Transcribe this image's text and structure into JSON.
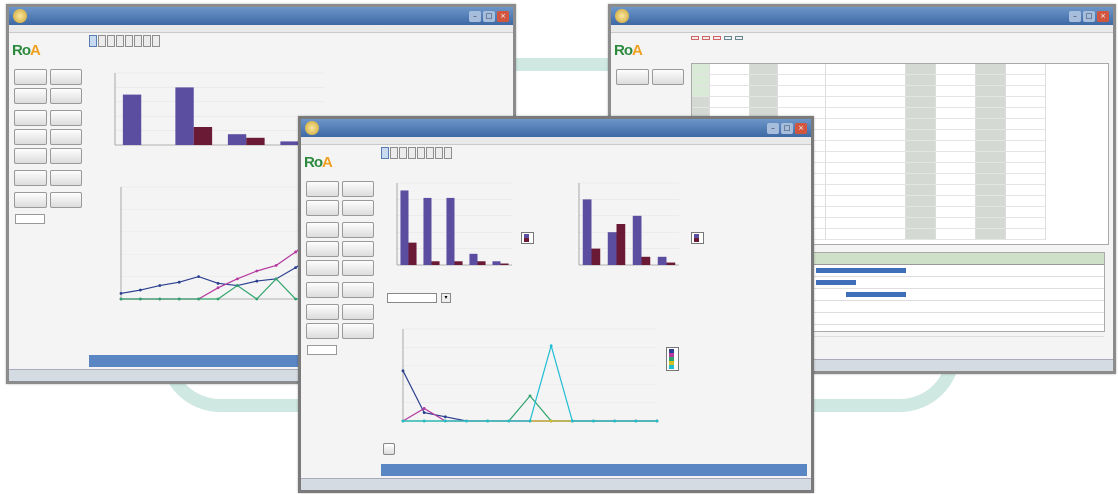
{
  "caption": "",
  "colors": {
    "bar_primary": "#5b4ea0",
    "bar_secondary": "#6b1a36",
    "line_a": "#2a3f8f",
    "line_b": "#b43aa0",
    "line_c": "#2ea36b",
    "line_d": "#d0c027",
    "line_e": "#1fbdd4",
    "status_blue": "#5a86c3"
  },
  "left_window": {
    "title": "",
    "tabs": [
      "",
      "",
      "",
      "",
      "",
      "",
      "",
      ""
    ],
    "chart_titles": [
      "",
      ""
    ],
    "sidebar": {
      "section_labels": [
        "",
        "",
        "",
        "",
        ""
      ],
      "buttons": [
        "",
        "",
        "",
        "",
        "",
        "",
        "",
        "",
        "",
        "",
        "",
        "",
        "",
        "",
        "",
        ""
      ],
      "footer_label": "",
      "footer_value": ""
    },
    "status": [
      "",
      ""
    ]
  },
  "center_window": {
    "title": "",
    "tabs": [
      "",
      "",
      "",
      "",
      "",
      "",
      "",
      ""
    ],
    "chart_titles": [
      "",
      "",
      ""
    ],
    "combo_label": "",
    "combo_value": "",
    "action_button": "",
    "legend_bar1": [
      "",
      ""
    ],
    "legend_bar2": [
      "",
      ""
    ],
    "legend_line": [
      "",
      "",
      "",
      "",
      ""
    ],
    "sidebar": {
      "section_labels": [
        "",
        "",
        "",
        "",
        ""
      ],
      "buttons": [
        "",
        "",
        "",
        "",
        "",
        "",
        "",
        "",
        "",
        "",
        "",
        "",
        "",
        "",
        "",
        ""
      ],
      "footer_label": "",
      "footer_value": ""
    },
    "status": [
      "",
      ""
    ]
  },
  "right_window": {
    "title": "",
    "toolbar": [
      "",
      "",
      "",
      "",
      ""
    ],
    "grid_rows": 16,
    "gantt_rows": 6
  },
  "chart_data": [
    {
      "id": "center-bar-1",
      "type": "bar",
      "title": "",
      "categories": [
        "",
        "",
        "",
        "",
        ""
      ],
      "series": [
        {
          "values": [
            100,
            90,
            90,
            15,
            5
          ]
        },
        {
          "values": [
            30,
            5,
            5,
            5,
            2
          ]
        }
      ],
      "ylim": [
        0,
        110
      ]
    },
    {
      "id": "center-bar-2",
      "type": "bar",
      "title": "",
      "categories": [
        "",
        "",
        "",
        ""
      ],
      "series": [
        {
          "values": [
            8,
            4,
            6,
            1
          ]
        },
        {
          "values": [
            2,
            5,
            1,
            0.3
          ]
        }
      ],
      "ylim": [
        0,
        10
      ]
    },
    {
      "id": "center-line",
      "type": "line",
      "title": "",
      "x": [
        "",
        "",
        "",
        "",
        "",
        "",
        "",
        "",
        "",
        "",
        "",
        "",
        ""
      ],
      "series": [
        {
          "values": [
            60,
            10,
            5,
            0,
            0,
            0,
            0,
            0,
            0,
            0,
            0,
            0,
            0
          ]
        },
        {
          "values": [
            0,
            15,
            0,
            0,
            0,
            0,
            0,
            0,
            0,
            0,
            0,
            0,
            0
          ]
        },
        {
          "values": [
            0,
            0,
            0,
            0,
            0,
            0,
            30,
            0,
            0,
            0,
            0,
            0,
            0
          ]
        },
        {
          "values": [
            0,
            0,
            0,
            0,
            0,
            0,
            0,
            0,
            0,
            0,
            0,
            0,
            0
          ]
        },
        {
          "values": [
            0,
            0,
            0,
            0,
            0,
            0,
            0,
            90,
            0,
            0,
            0,
            0,
            0
          ]
        }
      ],
      "ylim": [
        0,
        110
      ]
    },
    {
      "id": "left-bar",
      "type": "bar",
      "title": "",
      "categories": [
        "",
        "",
        "",
        ""
      ],
      "series": [
        {
          "values": [
            70,
            80,
            15,
            5
          ]
        },
        {
          "values": [
            0,
            25,
            10,
            5
          ]
        }
      ],
      "ylim": [
        0,
        100
      ]
    },
    {
      "id": "left-line",
      "type": "line",
      "title": "",
      "x": [
        "",
        "",
        "",
        "",
        "",
        "",
        "",
        "",
        "",
        "",
        ""
      ],
      "series": [
        {
          "values": [
            5,
            8,
            12,
            15,
            20,
            14,
            12,
            16,
            18,
            28,
            40
          ]
        },
        {
          "values": [
            0,
            0,
            0,
            0,
            0,
            10,
            18,
            25,
            30,
            42,
            55
          ]
        },
        {
          "values": [
            0,
            0,
            0,
            0,
            0,
            0,
            12,
            0,
            18,
            0,
            0
          ]
        }
      ],
      "ylim": [
        0,
        100
      ]
    }
  ]
}
